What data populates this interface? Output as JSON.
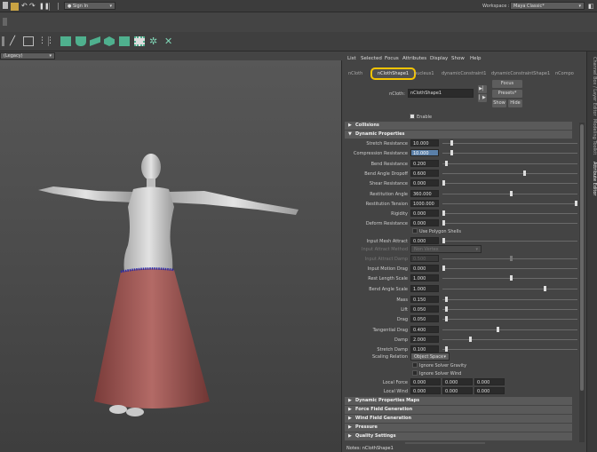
{
  "statusline": {
    "sign_in": "Sign In",
    "workspace_label": "Workspace :",
    "workspace_value": "Maya Classic*"
  },
  "viewport": {
    "panel_dropdown": "(Legacy)"
  },
  "ae": {
    "menu": [
      "List",
      "Selected",
      "Focus",
      "Attributes",
      "Display",
      "Show",
      "Help"
    ],
    "tabs": [
      "nCloth",
      "nClothShape1",
      "nucleus1",
      "dynamicConstraint1",
      "dynamicConstraintShape1",
      "nCompo"
    ],
    "node_label": "nCloth:",
    "node_value": "nClothShape1",
    "focus_btn": "Focus",
    "presets_btn": "Presets*",
    "show_btn": "Show",
    "hide_btn": "Hide",
    "enable_label": "Enable",
    "collisions_section": "Collisions",
    "dynamic_section": "Dynamic Properties",
    "dyn": [
      {
        "label": "Stretch Resistance",
        "value": "10.000",
        "knob": 0.06
      },
      {
        "label": "Compression Resistance",
        "value": "10.000",
        "knob": 0.06
      },
      {
        "label": "Bend Resistance",
        "value": "0.200",
        "knob": 0.02
      },
      {
        "label": "Bend Angle Dropoff",
        "value": "0.600",
        "knob": 0.6
      },
      {
        "label": "Shear Resistance",
        "value": "0.000",
        "knob": 0.0
      },
      {
        "label": "Restitution Angle",
        "value": "360.000",
        "knob": 0.5
      },
      {
        "label": "Restitution Tension",
        "value": "1000.000",
        "knob": 1.0
      },
      {
        "label": "Rigidity",
        "value": "0.000",
        "knob": 0.0
      },
      {
        "label": "Deform Resistance",
        "value": "0.000",
        "knob": 0.0
      }
    ],
    "use_polygon_shells": "Use Polygon Shells",
    "dyn2": [
      {
        "label": "Input Mesh Attract",
        "value": "0.000",
        "knob": 0.0,
        "dim": false
      },
      {
        "label": "Input Attract Damp",
        "value": "0.500",
        "knob": 0.5,
        "dim": true
      },
      {
        "label": "Input Motion Drag",
        "value": "0.000",
        "knob": 0.0,
        "dim": false
      },
      {
        "label": "Rest Length Scale",
        "value": "1.000",
        "knob": 0.5,
        "dim": false
      },
      {
        "label": "Bend Angle Scale",
        "value": "1.000",
        "knob": 0.75,
        "dim": false
      },
      {
        "label": "Mass",
        "value": "0.150",
        "knob": 0.02,
        "dim": false
      },
      {
        "label": "Lift",
        "value": "0.050",
        "knob": 0.02,
        "dim": false
      },
      {
        "label": "Drag",
        "value": "0.050",
        "knob": 0.02,
        "dim": false
      },
      {
        "label": "Tangential Drag",
        "value": "0.400",
        "knob": 0.4,
        "dim": false
      },
      {
        "label": "Damp",
        "value": "2.000",
        "knob": 0.2,
        "dim": false
      },
      {
        "label": "Stretch Damp",
        "value": "0.100",
        "knob": 0.02,
        "dim": false
      }
    ],
    "input_attract_method_label": "Input Attract Method",
    "input_attract_method_value": "Non Vertex",
    "scaling_relation_label": "Scaling Relation",
    "scaling_relation_value": "Object Space",
    "ignore_gravity": "Ignore Solver Gravity",
    "ignore_wind": "Ignore Solver Wind",
    "local_force_label": "Local Force",
    "local_force": [
      "0.000",
      "0.000",
      "0.000"
    ],
    "local_wind_label": "Local Wind",
    "local_wind": [
      "0.000",
      "0.000",
      "0.000"
    ],
    "collapsed_sections": [
      "Dynamic Properties Maps",
      "Force Field Generation",
      "Wind Field Generation",
      "Pressure",
      "Quality Settings"
    ],
    "notes": "Notes: nClothShape1"
  },
  "side_tabs": [
    "Channel Box / Layer Editor",
    "Modeling Toolkit",
    "Attribute Editor"
  ]
}
